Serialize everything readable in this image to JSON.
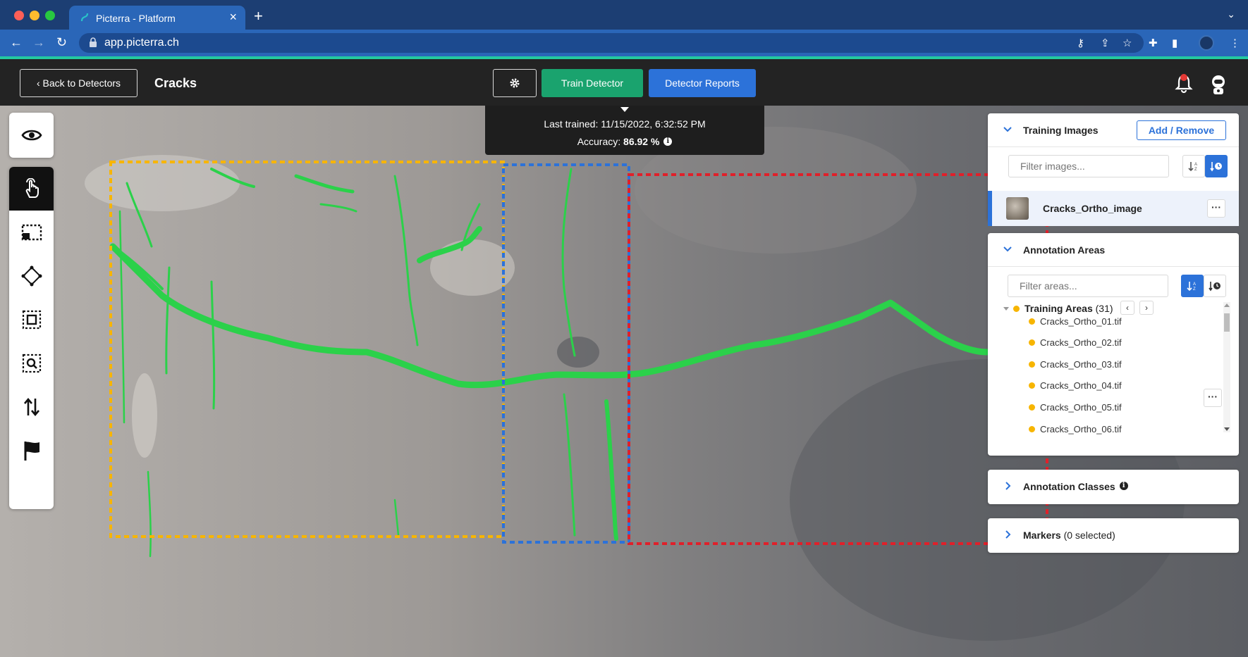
{
  "browser": {
    "tab_title": "Picterra - Platform",
    "url": "app.picterra.ch"
  },
  "header": {
    "back_label": "Back to Detectors",
    "title": "Cracks",
    "train_label": "Train Detector",
    "reports_label": "Detector Reports"
  },
  "training_status": {
    "last_trained": "Last trained: 11/15/2022, 6:32:52 PM",
    "accuracy_label": "Accuracy:",
    "accuracy_value": "86.92 %"
  },
  "toolbar": {
    "items": [
      "eye-icon",
      "pointer-hand-icon",
      "rectangle-select-icon",
      "polygon-icon",
      "magic-select-icon",
      "zoom-select-icon",
      "swap-arrows-icon",
      "flag-icon"
    ]
  },
  "training_images": {
    "title": "Training Images",
    "add_remove_label": "Add / Remove",
    "filter_placeholder": "Filter images...",
    "images": [
      {
        "name": "Cracks_Ortho_image"
      }
    ]
  },
  "annotation_areas": {
    "title": "Annotation Areas",
    "filter_placeholder": "Filter areas...",
    "group_label": "Training Areas",
    "group_count": "(31)",
    "items": [
      "Cracks_Ortho_01.tif",
      "Cracks_Ortho_02.tif",
      "Cracks_Ortho_03.tif",
      "Cracks_Ortho_04.tif",
      "Cracks_Ortho_05.tif",
      "Cracks_Ortho_06.tif"
    ]
  },
  "annotation_classes": {
    "title": "Annotation Classes"
  },
  "markers": {
    "title": "Markers",
    "status": "(0 selected)"
  },
  "colors": {
    "accent_green": "#1aa36e",
    "accent_blue": "#2c72d9",
    "crack_green": "#2bd14a",
    "area_orange": "#f7b500",
    "area_blue": "#2c72d9",
    "area_red": "#e0202a"
  }
}
